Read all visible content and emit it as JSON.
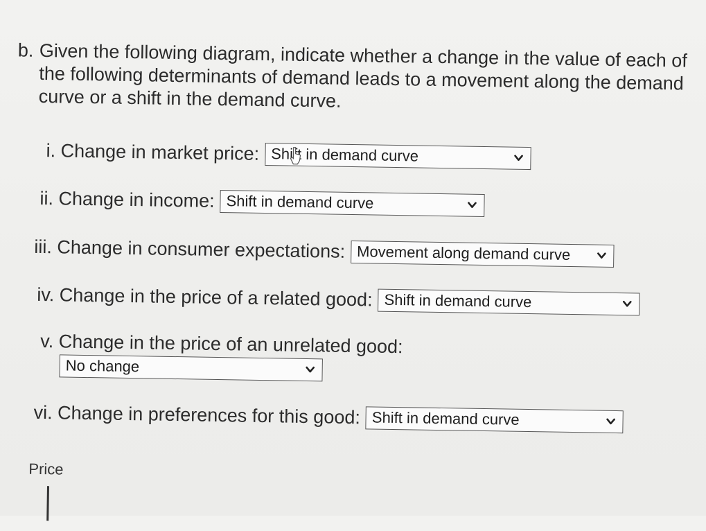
{
  "question": {
    "letter": "b.",
    "prompt": "Given the following diagram, indicate whether a change in the value of each of the following determinants of demand leads to a movement along the demand curve or a shift in the demand curve."
  },
  "items": [
    {
      "label": "i. Change in market price:",
      "selected": "Shift in demand curve"
    },
    {
      "label": "ii. Change in income:",
      "selected": "Shift in demand curve"
    },
    {
      "label": "iii. Change in consumer expectations:",
      "selected": "Movement along demand curve"
    },
    {
      "label": "iv. Change in the price of a related good:",
      "selected": "Shift in demand curve"
    },
    {
      "label": "v. Change in the price of an unrelated good:",
      "selected": "No change"
    },
    {
      "label": "vi. Change in preferences for this good:",
      "selected": "Shift in demand curve"
    }
  ],
  "diagram": {
    "y_axis_label": "Price"
  },
  "icons": {
    "dropdown": "chevron-down-icon",
    "pointer": "mouse-cursor-icon"
  }
}
